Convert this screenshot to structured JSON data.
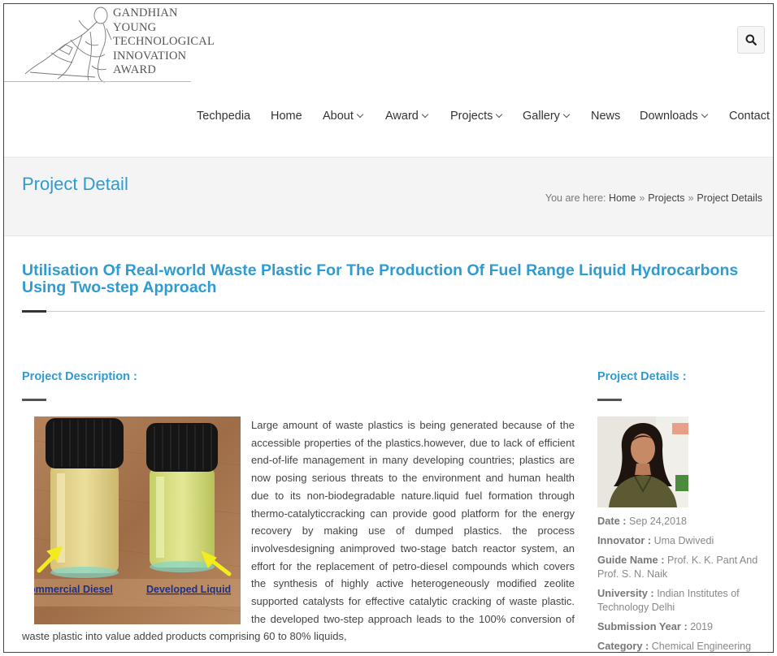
{
  "logo": {
    "lines": [
      "GANDHIAN",
      "YOUNG",
      "TECHNOLOGICAL",
      "INNOVATION",
      "AWARD"
    ]
  },
  "header": {
    "search_icon": "search-icon"
  },
  "nav": {
    "items": [
      {
        "label": "Techpedia",
        "dropdown": false
      },
      {
        "label": "Home",
        "dropdown": false
      },
      {
        "label": "About",
        "dropdown": true
      },
      {
        "label": "Award",
        "dropdown": true
      },
      {
        "label": "Projects",
        "dropdown": true
      },
      {
        "label": "Gallery",
        "dropdown": true
      },
      {
        "label": "News",
        "dropdown": false
      },
      {
        "label": "Downloads",
        "dropdown": true
      },
      {
        "label": "Contact",
        "dropdown": false
      }
    ]
  },
  "page": {
    "title": "Project Detail",
    "breadcrumb": {
      "prefix": "You are here:",
      "items": [
        "Home",
        "Projects",
        "Project Details"
      ],
      "separator": "»"
    }
  },
  "project": {
    "title": "Utilisation Of Real-world Waste Plastic For The Production Of Fuel Range Liquid Hydrocarbons Using Two-step Approach",
    "description_heading": "Project Description :",
    "details_heading": "Project Details :",
    "image_labels": {
      "left": "ommercial Diesel",
      "right": "Developed Liquid"
    },
    "description": "Large amount of waste plastics is being generated because of the accessible properties of the plastics.however, due to lack of efficient end-of-life management in many developing countries; plastics are now posing serious threats to the environment and human health due to its non-biodegradable nature.liquid fuel formation through thermo-catalyticcracking can provide good platform for the energy recovery by making use of dumped plastics. the process involvesdesigning animproved two-stage batch reactor system, an effort for the replacement of petro-diesel compounds which covers the synthesis of highly active heterogeneously modified zeolite supported catalysts for effective catalytic cracking of waste plastic. the developed two-step approach leads to the 100% conversion of waste plastic into value added products comprising 60 to 80% liquids,",
    "details": [
      {
        "label": "Date :",
        "value": "Sep 24,2018"
      },
      {
        "label": "Innovator :",
        "value": "Uma Dwivedi"
      },
      {
        "label": "Guide Name :",
        "value": "Prof. K. K. Pant And Prof. S. N. Naik"
      },
      {
        "label": "University :",
        "value": "Indian Institutes of Technology Delhi"
      },
      {
        "label": "Submission Year :",
        "value": "2019"
      },
      {
        "label": "Category :",
        "value": "Chemical Engineering"
      }
    ]
  },
  "colors": {
    "accent": "#2e9bd1",
    "titlebar_bg": "#f4f4f4",
    "text": "#444444"
  }
}
